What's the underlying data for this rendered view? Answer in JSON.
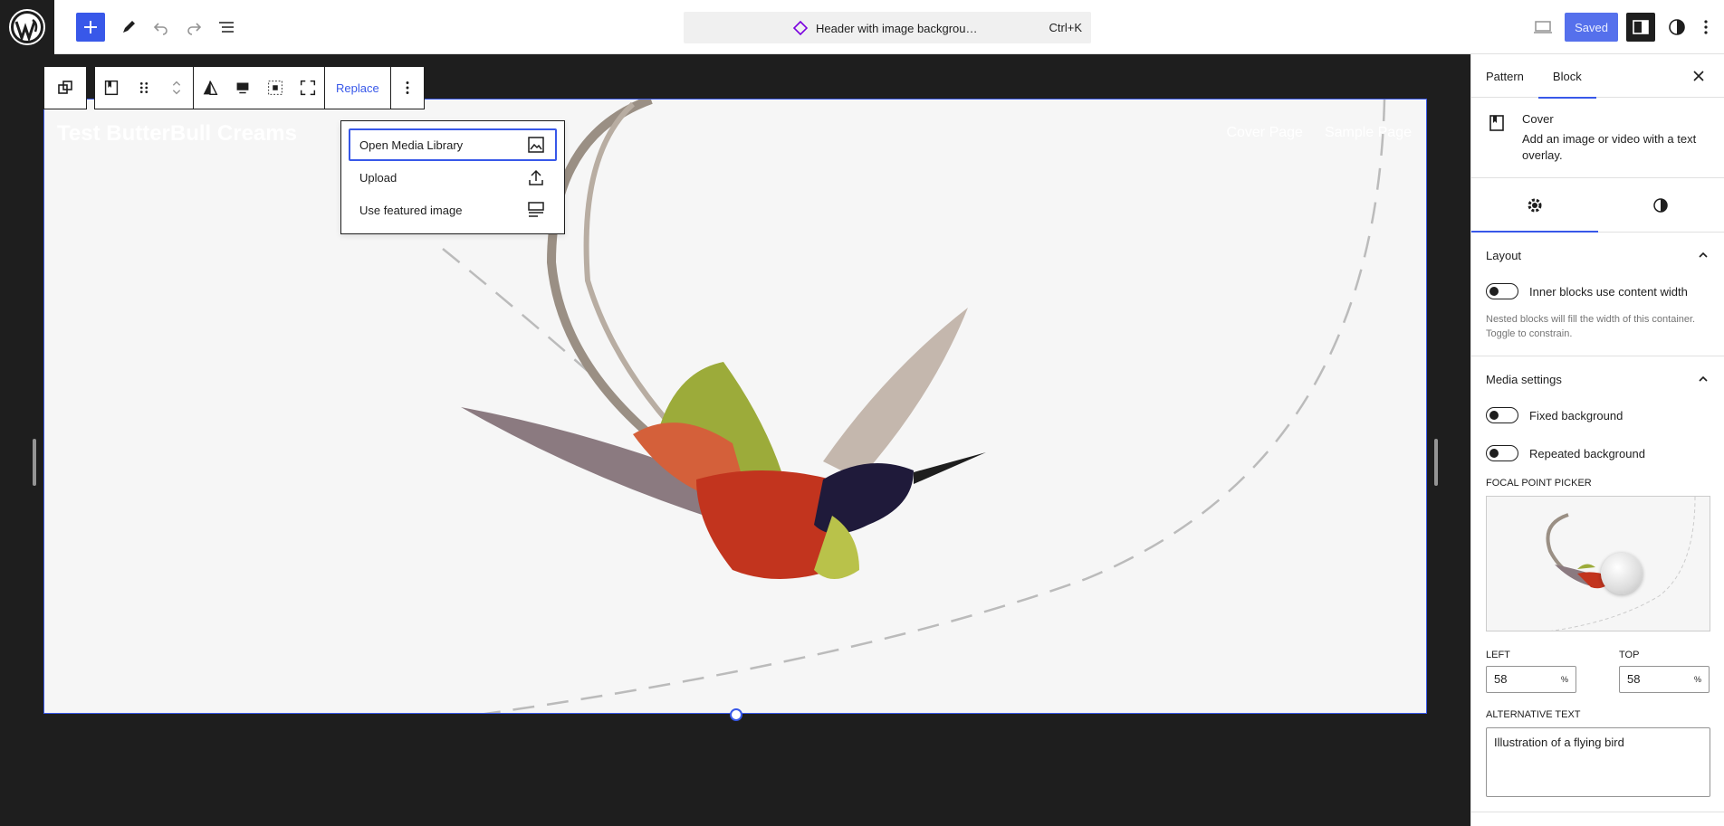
{
  "topbar": {
    "command_title": "Header with image backgrou…",
    "command_shortcut": "Ctrl+K",
    "saved_label": "Saved"
  },
  "cover": {
    "site_title": "Test ButterBull Creams",
    "nav": [
      "Cover Page",
      "Sample Page"
    ]
  },
  "block_toolbar": {
    "replace_label": "Replace"
  },
  "replace_menu": {
    "items": [
      {
        "label": "Open Media Library",
        "icon": "image-icon"
      },
      {
        "label": "Upload",
        "icon": "upload-icon"
      },
      {
        "label": "Use featured image",
        "icon": "featured-image-icon"
      }
    ]
  },
  "sidebar": {
    "tabs": [
      "Pattern",
      "Block"
    ],
    "active_tab": "Block",
    "block_card": {
      "title": "Cover",
      "description": "Add an image or video with a text overlay."
    },
    "layout": {
      "title": "Layout",
      "toggle_label": "Inner blocks use content width",
      "help": "Nested blocks will fill the width of this container. Toggle to constrain."
    },
    "media": {
      "title": "Media settings",
      "fixed_label": "Fixed background",
      "repeated_label": "Repeated background",
      "focal_label": "FOCAL POINT PICKER",
      "left_label": "LEFT",
      "left_value": "58",
      "top_label": "TOP",
      "top_value": "58",
      "unit": "%",
      "alt_label": "ALTERNATIVE TEXT",
      "alt_value": "Illustration of a flying bird"
    }
  },
  "colors": {
    "accent": "#3858e9",
    "dark": "#1e1e1e"
  }
}
